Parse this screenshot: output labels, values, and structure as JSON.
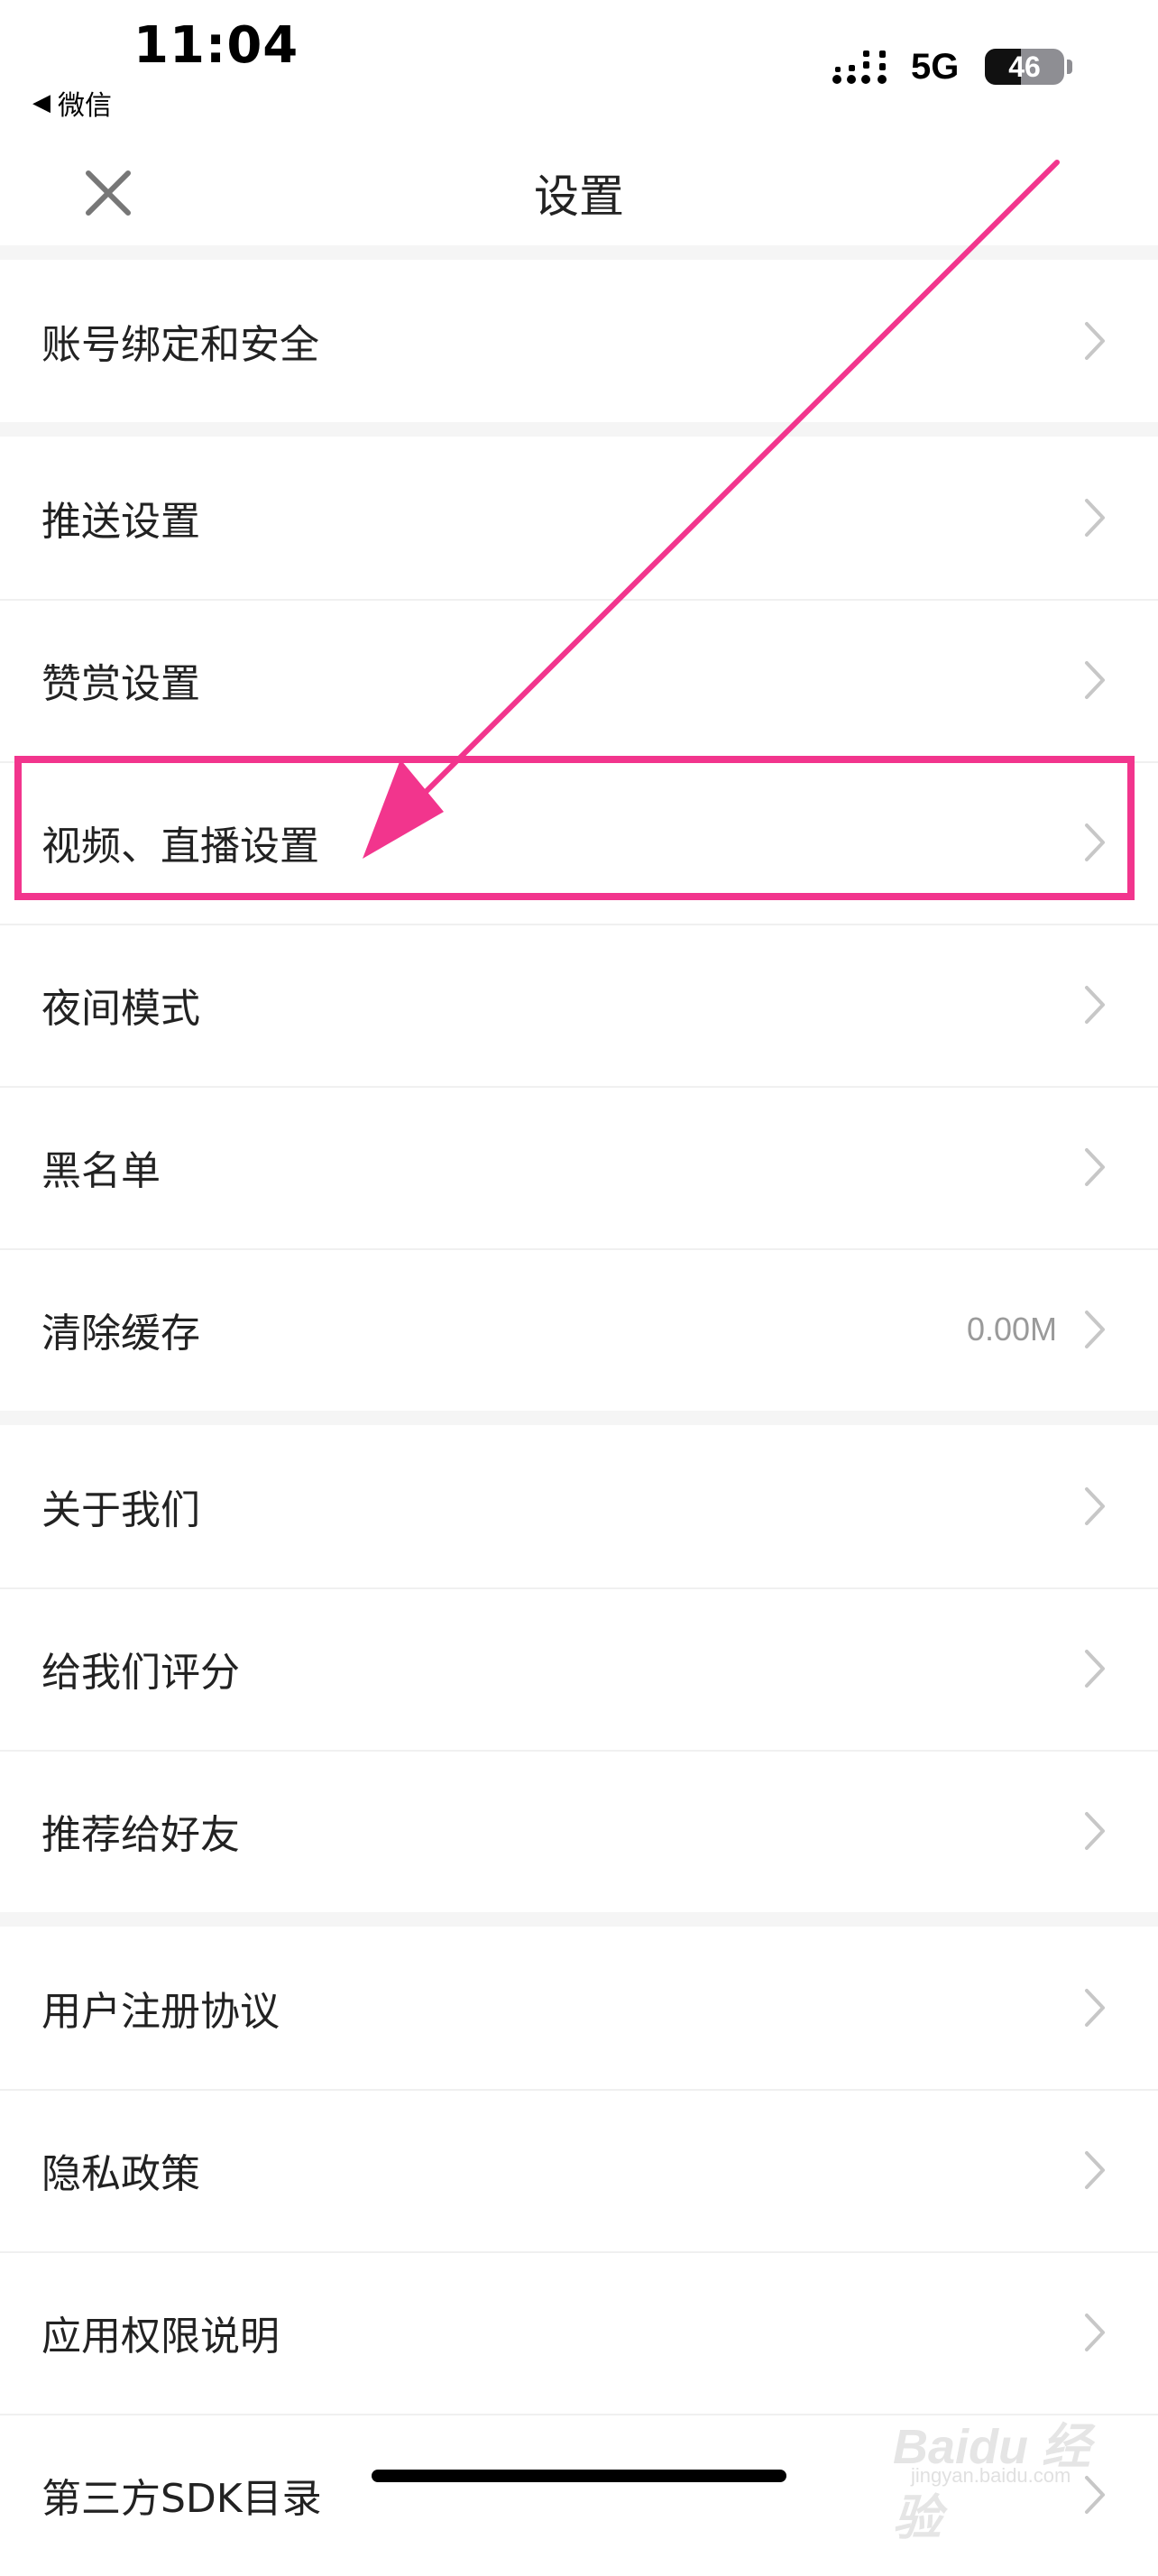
{
  "status_bar": {
    "time": "11:04",
    "back_app": "微信",
    "network": "5G",
    "battery_level": "46",
    "battery_fraction": 0.46
  },
  "nav": {
    "title": "设置",
    "close_icon": "close-icon"
  },
  "groups": [
    {
      "items": [
        {
          "label": "账号绑定和安全"
        }
      ]
    },
    {
      "items": [
        {
          "label": "推送设置"
        },
        {
          "label": "赞赏设置"
        },
        {
          "label": "视频、直播设置",
          "highlighted": true
        },
        {
          "label": "夜间模式"
        },
        {
          "label": "黑名单"
        },
        {
          "label": "清除缓存",
          "value": "0.00M"
        }
      ]
    },
    {
      "items": [
        {
          "label": "关于我们"
        },
        {
          "label": "给我们评分"
        },
        {
          "label": "推荐给好友"
        }
      ]
    },
    {
      "items": [
        {
          "label": "用户注册协议"
        },
        {
          "label": "隐私政策"
        },
        {
          "label": "应用权限说明"
        },
        {
          "label": "第三方SDK目录"
        }
      ]
    }
  ],
  "watermark": {
    "text": "Baidu 经验",
    "sub": "jingyan.baidu.com"
  },
  "colors": {
    "highlight": "#f2358d",
    "chevron": "#c7c7c7",
    "separator": "#f5f5f5"
  }
}
